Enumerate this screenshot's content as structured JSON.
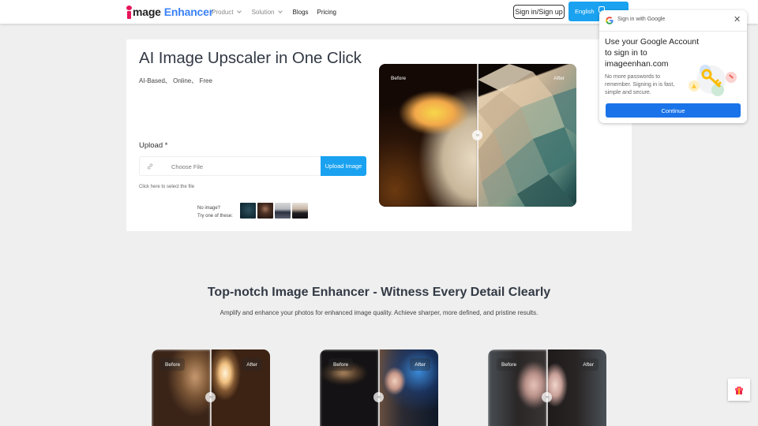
{
  "header": {
    "logo": {
      "first_letter": "i",
      "word_rest": "mage",
      "word_accent": "Enhancer"
    },
    "nav": [
      {
        "label": "Product",
        "has_dropdown": true
      },
      {
        "label": "Solution",
        "has_dropdown": true
      },
      {
        "label": "Blogs",
        "has_dropdown": false
      },
      {
        "label": "Pricing",
        "has_dropdown": false
      }
    ],
    "signin_label": "Sign in/Sign up",
    "language_label": "English",
    "accent_color": "#1aa2f0",
    "brand_color": "#3b82f6"
  },
  "hero": {
    "title": "AI Image Upscaler in One Click",
    "tags": [
      "AI-Based",
      "Online",
      "Free"
    ],
    "tags_text": "AI-Based、 Online、 Free",
    "upload_label": "Upload *",
    "file_placeholder": "Choose File",
    "upload_button": "Upload Image",
    "hint": "Click here to select the file",
    "no_image_line1": "No image?",
    "no_image_line2": "Try one of these:",
    "sample_images": [
      "man-portrait-teal",
      "woman-portrait-dark",
      "man-suit",
      "man-black-sweater"
    ],
    "compare": {
      "before_label": "Before",
      "after_label": "After",
      "subject": "eagle"
    }
  },
  "google_popup": {
    "header": "Sign in with Google",
    "title": "Use your Google Account to sign in to imageenhan.com",
    "body": "No more passwords to remember. Signing in is fast, simple and secure.",
    "continue_label": "Continue",
    "button_color": "#1a73e8"
  },
  "section": {
    "title": "Top-notch Image Enhancer - Witness Every Detail Clearly",
    "subtitle": "Amplify and enhance your photos for enhanced image quality. Achieve sharper, more defined, and pristine results.",
    "cards": [
      {
        "before_label": "Before",
        "after_label": "After",
        "subject": "sunlit-bedroom"
      },
      {
        "before_label": "Before",
        "after_label": "After",
        "subject": "woman-bokeh-night"
      },
      {
        "before_label": "Before",
        "after_label": "After",
        "subject": "woman-long-hair"
      }
    ]
  },
  "floating": {
    "gift_icon": "gift-icon"
  }
}
